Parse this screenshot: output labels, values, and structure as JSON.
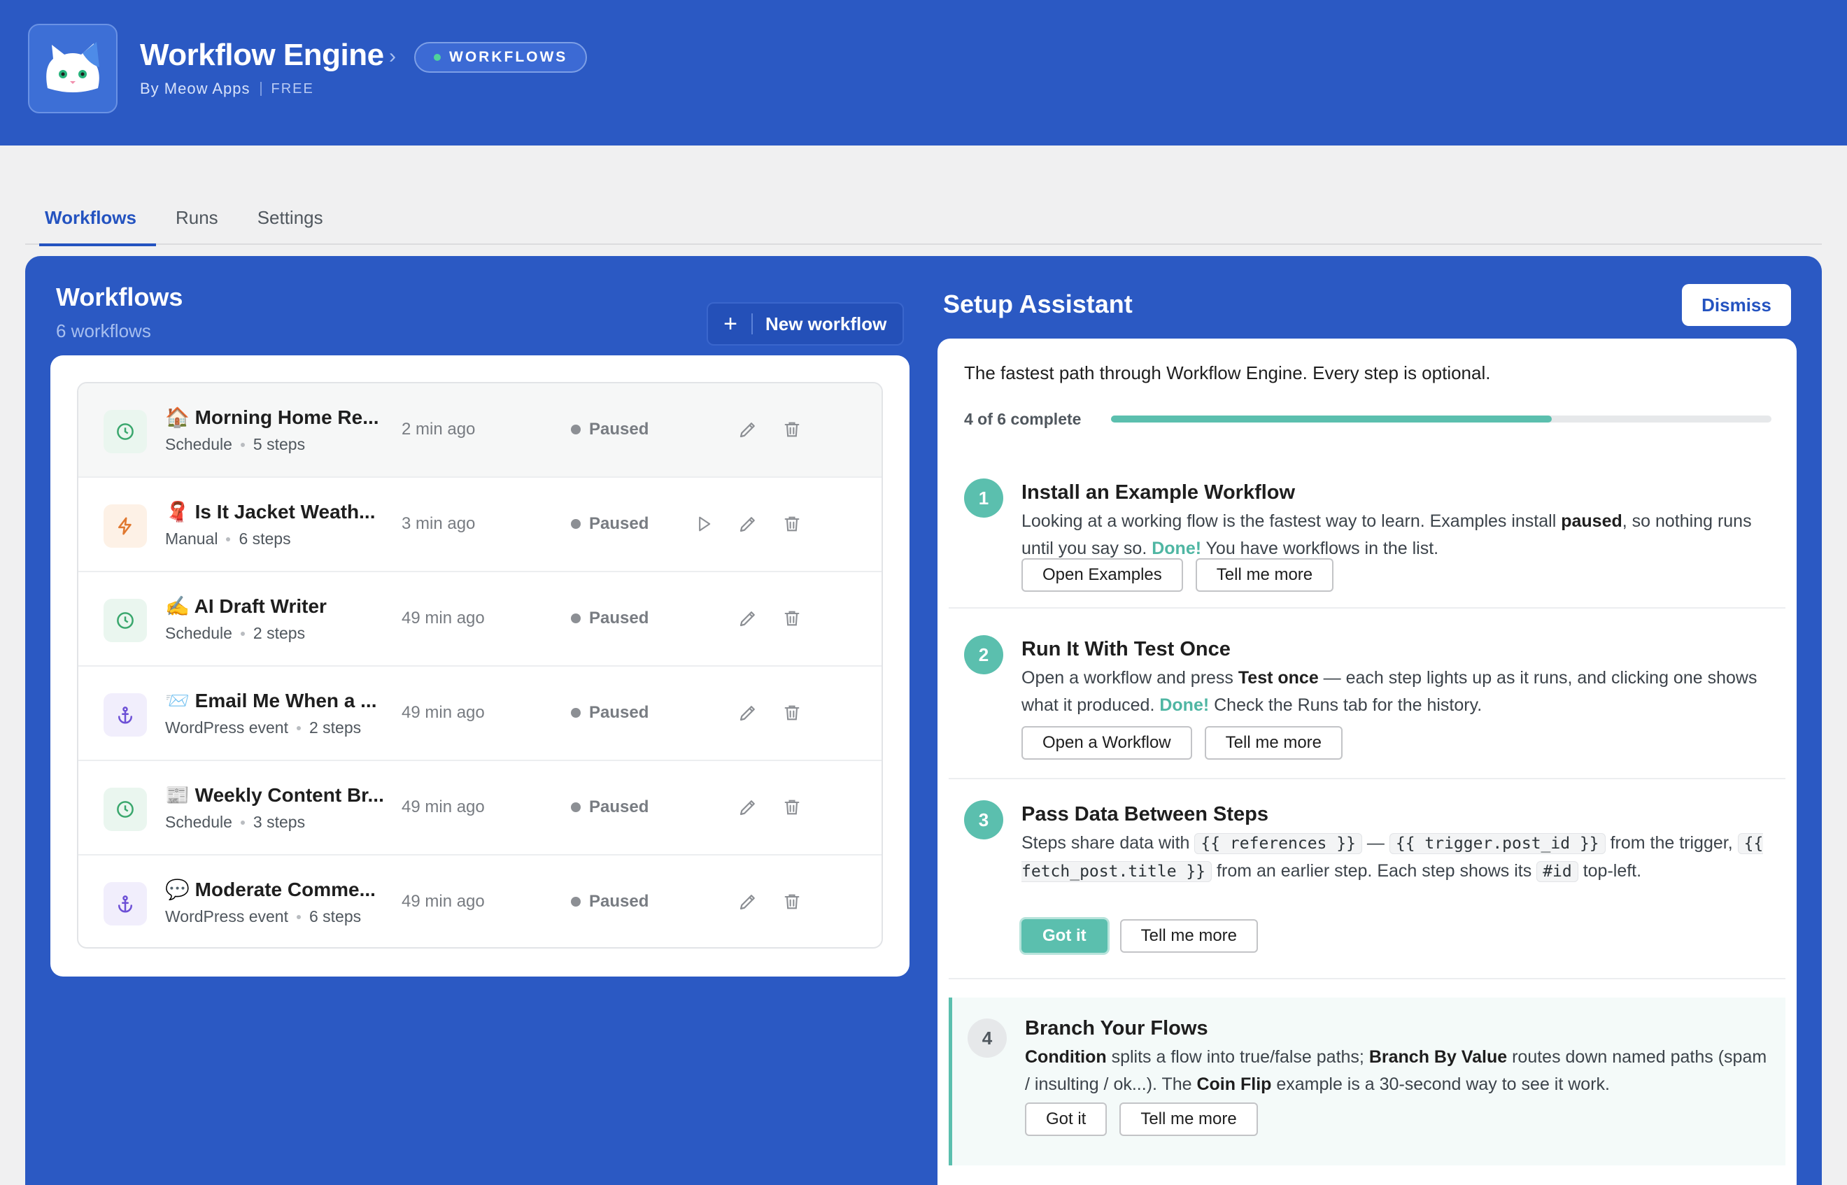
{
  "header": {
    "title": "Workflow Engine",
    "by": "By Meow Apps",
    "plan": "FREE",
    "badge": "WORKFLOWS",
    "accent": "#2b59c3"
  },
  "tabs": [
    {
      "label": "Workflows",
      "active": true
    },
    {
      "label": "Runs",
      "active": false
    },
    {
      "label": "Settings",
      "active": false
    }
  ],
  "workflows": {
    "title": "Workflows",
    "count_label": "6 workflows",
    "new_label": "New workflow",
    "items": [
      {
        "emoji": "🏠",
        "name": "Morning Home Re...",
        "trigger": "Schedule",
        "steps": "5 steps",
        "ago": "2 min ago",
        "status": "Paused",
        "icon": "clock-icon"
      },
      {
        "emoji": "🧣",
        "name": "Is It Jacket Weath...",
        "trigger": "Manual",
        "steps": "6 steps",
        "ago": "3 min ago",
        "status": "Paused",
        "icon": "bolt-icon"
      },
      {
        "emoji": "✍️",
        "name": "AI Draft Writer",
        "trigger": "Schedule",
        "steps": "2 steps",
        "ago": "49 min ago",
        "status": "Paused",
        "icon": "clock-icon"
      },
      {
        "emoji": "📨",
        "name": "Email Me When a ...",
        "trigger": "WordPress event",
        "steps": "2 steps",
        "ago": "49 min ago",
        "status": "Paused",
        "icon": "anchor-icon"
      },
      {
        "emoji": "📰",
        "name": "Weekly Content Br...",
        "trigger": "Schedule",
        "steps": "3 steps",
        "ago": "49 min ago",
        "status": "Paused",
        "icon": "clock-icon"
      },
      {
        "emoji": "💬",
        "name": "Moderate Comme...",
        "trigger": "WordPress event",
        "steps": "6 steps",
        "ago": "49 min ago",
        "status": "Paused",
        "icon": "anchor-icon"
      }
    ]
  },
  "setup": {
    "title": "Setup Assistant",
    "dismiss_label": "Dismiss",
    "intro": "The fastest path through Workflow Engine. Every step is optional.",
    "progress_label": "4 of 6 complete",
    "progress": 0.667,
    "steps": [
      {
        "num": "1",
        "title": "Install an Example Workflow",
        "t1": "Looking at a working flow is the fastest way to learn. Examples install ",
        "b1": "paused",
        "t2": ", so nothing runs until you say so. ",
        "done": "Done!",
        "t3": " You have workflows in the list.",
        "btn1": "Open Examples",
        "btn2": "Tell me more"
      },
      {
        "num": "2",
        "title": "Run It With Test Once",
        "t1": "Open a workflow and press ",
        "b1": "Test once",
        "t2": " — each step lights up as it runs, and clicking one shows what it produced. ",
        "done": "Done!",
        "t3": " Check the Runs tab for the history.",
        "btn1": "Open a Workflow",
        "btn2": "Tell me more"
      },
      {
        "num": "3",
        "title": "Pass Data Between Steps",
        "t1": "Steps share data with ",
        "c1": "{{ references }}",
        "t2": " — ",
        "c2": "{{ trigger.post_id }}",
        "t3": " from the trigger, ",
        "c3": "{{ fetch_post.title }}",
        "t4": " from an earlier step. Each step shows its ",
        "c4": "#id",
        "t5": " top-left.",
        "btn1": "Got it",
        "btn2": "Tell me more"
      },
      {
        "num": "4",
        "title": "Branch Your Flows",
        "b1": "Condition",
        "t1": " splits a flow into true/false paths; ",
        "b2": "Branch By Value",
        "t2": " routes down named paths (spam / insulting / ok...). The ",
        "b3": "Coin Flip",
        "t3": " example is a 30-second way to see it work.",
        "btn1": "Got it",
        "btn2": "Tell me more"
      }
    ]
  }
}
